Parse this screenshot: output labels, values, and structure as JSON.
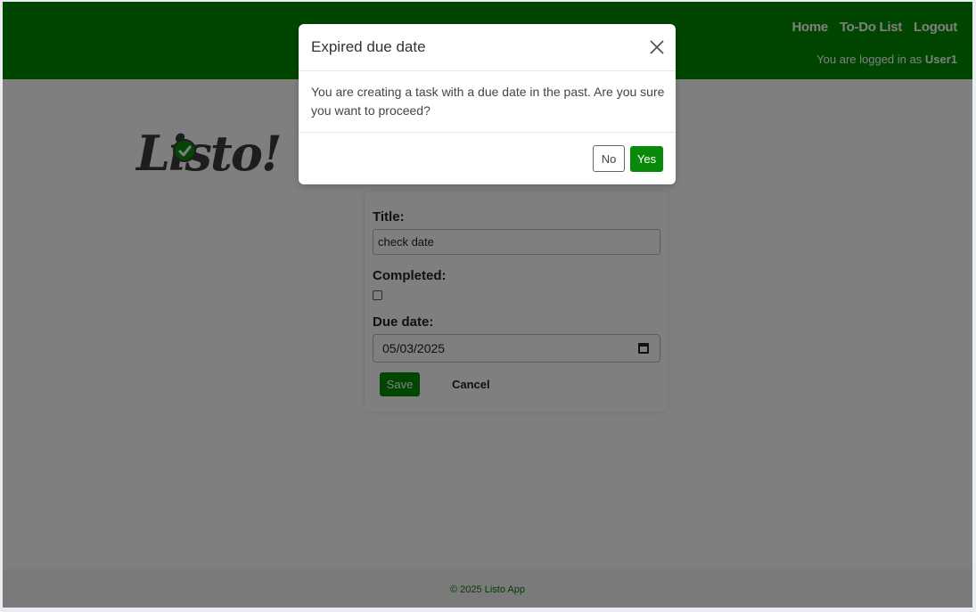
{
  "navbar": {
    "links": [
      "Home",
      "To-Do List",
      "Logout"
    ],
    "login_prefix": "You are logged in as",
    "username": "User1"
  },
  "logo": {
    "text": "Listo!"
  },
  "form": {
    "title_label": "Title:",
    "title_value": "check date",
    "completed_label": "Completed:",
    "completed_checked": false,
    "due_label": "Due date:",
    "due_value": "05/03/2025",
    "save_label": "Save",
    "cancel_label": "Cancel"
  },
  "footer": {
    "text": "© 2025 Listo App"
  },
  "modal": {
    "title": "Expired due date",
    "body": "You are creating a task with a due date in the past. Are you sure you want to proceed?",
    "no_label": "No",
    "yes_label": "Yes"
  },
  "colors": {
    "brand_green": "#008c00",
    "overlay": "rgba(0,0,0,0.5)"
  },
  "icons": {
    "close": "close-icon",
    "calendar": "calendar-icon",
    "logo_check": "check-circle-icon"
  }
}
